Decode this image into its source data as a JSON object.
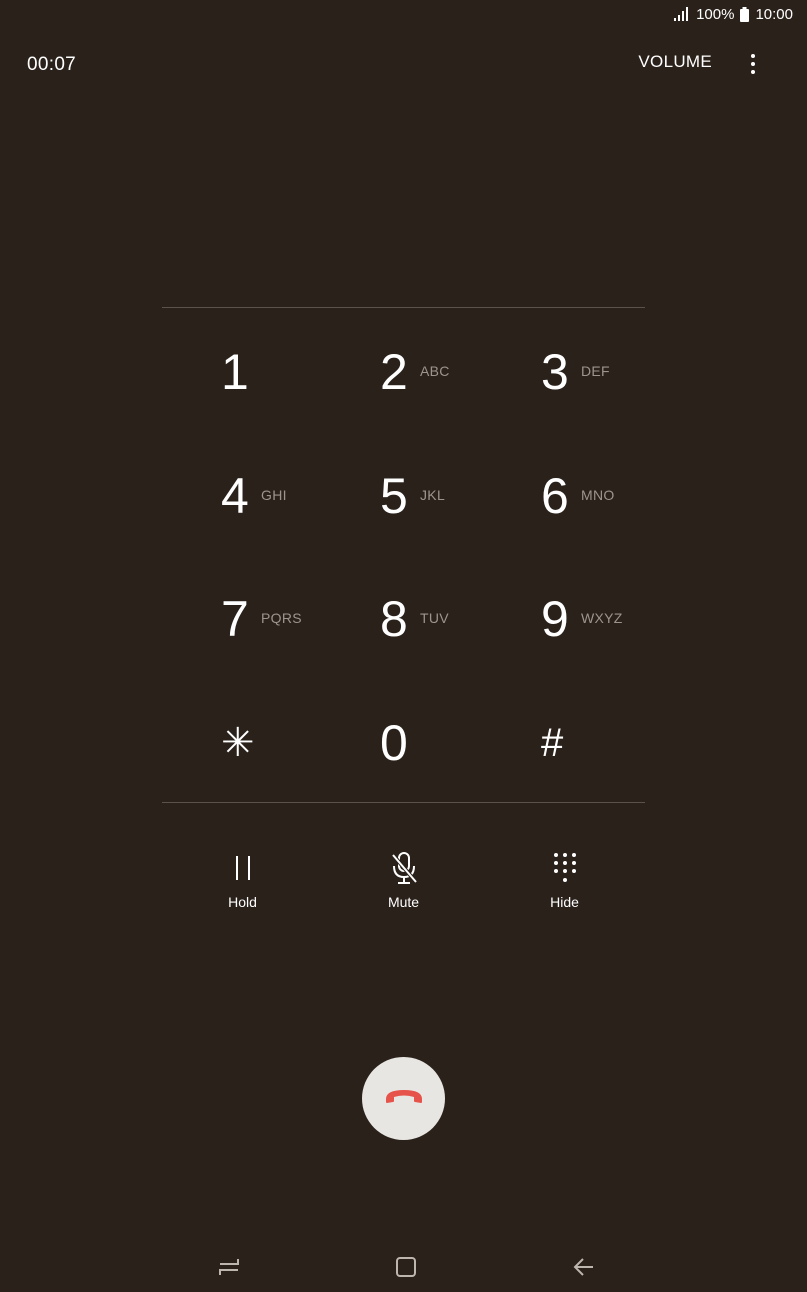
{
  "status_bar": {
    "battery": "100%",
    "time": "10:00",
    "icons": [
      "signal-icon",
      "battery-icon"
    ]
  },
  "header": {
    "timer": "00:07",
    "volume_label": "VOLUME",
    "more_icon": "more-vert-icon"
  },
  "keypad": {
    "keys": [
      {
        "digit": "1",
        "letters": ""
      },
      {
        "digit": "2",
        "letters": "ABC"
      },
      {
        "digit": "3",
        "letters": "DEF"
      },
      {
        "digit": "4",
        "letters": "GHI"
      },
      {
        "digit": "5",
        "letters": "JKL"
      },
      {
        "digit": "6",
        "letters": "MNO"
      },
      {
        "digit": "7",
        "letters": "PQRS"
      },
      {
        "digit": "8",
        "letters": "TUV"
      },
      {
        "digit": "9",
        "letters": "WXYZ"
      },
      {
        "digit": "✳",
        "letters": ""
      },
      {
        "digit": "0",
        "letters": ""
      },
      {
        "digit": "#",
        "letters": ""
      }
    ]
  },
  "actions": [
    {
      "label": "Hold",
      "icon": "pause-icon"
    },
    {
      "label": "Mute",
      "icon": "mic-off-icon"
    },
    {
      "label": "Hide",
      "icon": "dialpad-icon"
    }
  ],
  "end_call": {
    "icon": "end-call-icon",
    "color": "#e5534b"
  },
  "nav_bar": {
    "icons": [
      "recent-apps-icon",
      "home-icon",
      "back-icon"
    ]
  },
  "colors": {
    "background": "#2a211a",
    "divider": "#5c5249",
    "secondary_text": "#9d958d",
    "end_call_bg": "#e8e6e3",
    "end_call_icon": "#e5534b"
  }
}
